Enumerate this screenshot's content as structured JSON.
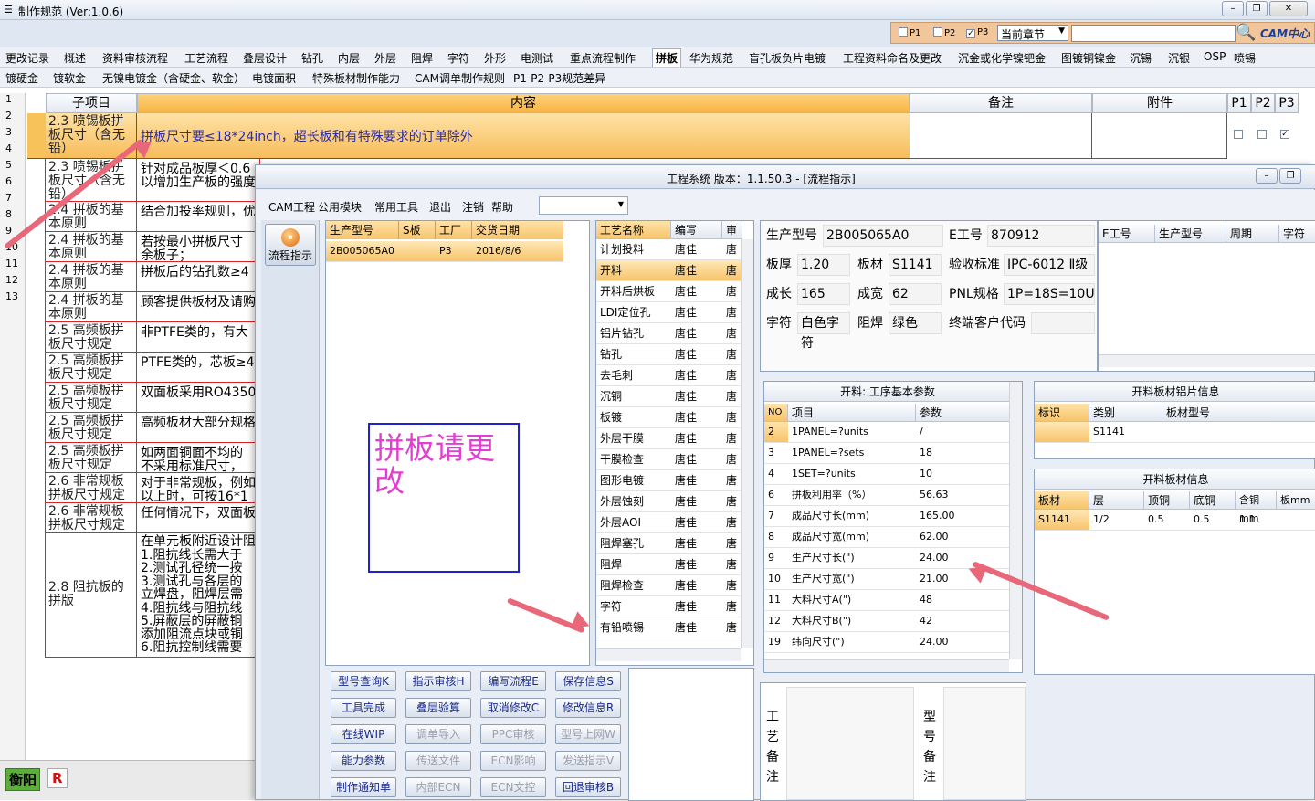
{
  "app": {
    "title": "制作规范 (Ver:1.0.6)"
  },
  "filter": {
    "p1": "P1",
    "p2": "P2",
    "p3": "P3",
    "scope": "当前章节",
    "logo": "CAM中心"
  },
  "tabs_row1": [
    "更改记录",
    "概述",
    "资料审核流程",
    "工艺流程",
    "叠层设计",
    "钻孔",
    "内层",
    "外层",
    "阻焊",
    "字符",
    "外形",
    "电测试",
    "重点流程制作",
    "拼板",
    "华为规范",
    "盲孔板负片电镀",
    "工程资料命名及更改",
    "沉金或化学镍钯金",
    "图镀铜镍金",
    "沉锡",
    "沉银",
    "OSP",
    "喷锡"
  ],
  "tabs_row2": [
    "镀硬金",
    "镀软金",
    "无镍电镀金（含硬金、软金）",
    "电镀面积",
    "特殊板材制作能力",
    "CAM调单制作规则",
    "P1-P2-P3规范差异"
  ],
  "grid": {
    "headers": {
      "sub": "子项目",
      "content": "内容",
      "remark": "备注",
      "attach": "附件",
      "p1": "P1",
      "p2": "P2",
      "p3": "P3"
    },
    "row_numbers": [
      "1",
      "2",
      "3",
      "4",
      "5",
      "6",
      "7",
      "8",
      "9",
      "10",
      "11",
      "12",
      "13"
    ],
    "rows": [
      {
        "sub": "2.3 喷锡板拼板尺寸（含无铅）",
        "content": "拼板尺寸要≤18*24inch，超长板和有特殊要求的订单除外"
      },
      {
        "sub": "2.3 喷锡板拼板尺寸（含无铅）",
        "content": "针对成品板厚＜0.6\n以增加生产板的强度"
      },
      {
        "sub": "2.4 拼板的基本原则",
        "content": "结合加投率规则，优"
      },
      {
        "sub": "2.4 拼板的基本原则",
        "content": "若按最小拼板尺寸\n余板子；"
      },
      {
        "sub": "2.4 拼板的基本原则",
        "content": "拼板后的钻孔数≥4"
      },
      {
        "sub": "2.4 拼板的基本原则",
        "content": "顾客提供板材及请购"
      },
      {
        "sub": "2.5 高频板拼板尺寸规定",
        "content": "非PTFE类的，有大"
      },
      {
        "sub": "2.5 高频板拼板尺寸规定",
        "content": "PTFE类的，芯板≥4"
      },
      {
        "sub": "2.5 高频板拼板尺寸规定",
        "content": "双面板采用RO4350"
      },
      {
        "sub": "2.5 高频板拼板尺寸规定",
        "content": "高频板材大部分规格"
      },
      {
        "sub": "2.5 高频板拼板尺寸规定",
        "content": "如两面铜面不均的\n不采用标准尺寸，"
      },
      {
        "sub": "2.6 非常规板拼板尺寸规定",
        "content": "对于非常规板，例如\n以上时，可按16*1"
      },
      {
        "sub": "2.6 非常规板拼板尺寸规定",
        "content": "任何情况下，双面板"
      },
      {
        "sub": "2.8 阻抗板的拼版",
        "content": "在单元板附近设计阻\n1.阻抗线长需大于\n2.测试孔径统一按\n3.测试孔与各层的\n立焊盘，阻焊层需\n4.阻抗线与阻抗线\n5.屏蔽层的屏蔽铜\n添加阻流点块或铜\n6.阻抗控制线需要"
      }
    ]
  },
  "status": {
    "site": "衡阳",
    "flag": "R"
  },
  "child": {
    "title": "工程系统  版本：1.1.50.3 - [流程指示]",
    "menu": [
      "CAM工程",
      "公用模块",
      "常用工具",
      "退出",
      "注销",
      "帮助"
    ],
    "nav_button": "流程指示",
    "jobs": {
      "headers": [
        "生产型号",
        "S板",
        "工厂",
        "交货日期"
      ],
      "rows": [
        {
          "model": "2B005065A0",
          "s": "",
          "factory": "P3",
          "date": "2016/8/6"
        }
      ]
    },
    "note_text": "拼板请更改",
    "process": {
      "headers": [
        "工艺名称",
        "编写",
        "审"
      ],
      "rows": [
        {
          "name": "计划投料",
          "author": "唐佳",
          "rev": "唐"
        },
        {
          "name": "开料",
          "author": "唐佳",
          "rev": "唐"
        },
        {
          "name": "开料后烘板",
          "author": "唐佳",
          "rev": "唐"
        },
        {
          "name": "LDI定位孔",
          "author": "唐佳",
          "rev": "唐"
        },
        {
          "name": "铝片钻孔",
          "author": "唐佳",
          "rev": "唐"
        },
        {
          "name": "钻孔",
          "author": "唐佳",
          "rev": "唐"
        },
        {
          "name": "去毛刺",
          "author": "唐佳",
          "rev": "唐"
        },
        {
          "name": "沉铜",
          "author": "唐佳",
          "rev": "唐"
        },
        {
          "name": "板镀",
          "author": "唐佳",
          "rev": "唐"
        },
        {
          "name": "外层干膜",
          "author": "唐佳",
          "rev": "唐"
        },
        {
          "name": "干膜检查",
          "author": "唐佳",
          "rev": "唐"
        },
        {
          "name": "图形电镀",
          "author": "唐佳",
          "rev": "唐"
        },
        {
          "name": "外层蚀刻",
          "author": "唐佳",
          "rev": "唐"
        },
        {
          "name": "外层AOI",
          "author": "唐佳",
          "rev": "唐"
        },
        {
          "name": "阻焊塞孔",
          "author": "唐佳",
          "rev": "唐"
        },
        {
          "name": "阻焊",
          "author": "唐佳",
          "rev": "唐"
        },
        {
          "name": "阻焊检查",
          "author": "唐佳",
          "rev": "唐"
        },
        {
          "name": "字符",
          "author": "唐佳",
          "rev": "唐"
        },
        {
          "name": "有铅喷锡",
          "author": "唐佳",
          "rev": "唐"
        }
      ]
    },
    "buttons": [
      [
        "型号查询K",
        "指示审核H",
        "编写流程E",
        "保存信息S"
      ],
      [
        "工具完成",
        "叠层验算",
        "取消修改C",
        "修改信息R"
      ],
      [
        "在线WIP",
        "调单导入",
        "PPC审核",
        "型号上网W"
      ],
      [
        "能力参数",
        "传送文件",
        "ECN影响",
        "发送指示V"
      ],
      [
        "制作通知单",
        "内部ECN",
        "ECN文控",
        "回退审核B"
      ]
    ],
    "info": {
      "model_label": "生产型号",
      "model": "2B005065A0",
      "eno_label": "E工号",
      "eno": "870912",
      "thick_label": "板厚",
      "thick": "1.20",
      "mat_label": "板材",
      "mat": "S1141",
      "std_label": "验收标准",
      "std": "IPC-6012 Ⅱ级",
      "len_label": "成长",
      "len": "165",
      "wid_label": "成宽",
      "wid": "62",
      "pnl_label": "PNL规格",
      "pnl": "1P=18S=10U",
      "char_label": "字符",
      "char": "白色字符",
      "mask_label": "阻焊",
      "mask": "绿色",
      "cust_label": "终端客户代码",
      "cust": ""
    },
    "history_headers": [
      "E工号",
      "生产型号",
      "周期",
      "字符"
    ],
    "params": {
      "title": "开料: 工序基本参数",
      "headers": [
        "NO",
        "项目",
        "参数"
      ],
      "rows": [
        {
          "no": "2",
          "item": "1PANEL=?units",
          "val": "/"
        },
        {
          "no": "3",
          "item": "1PANEL=?sets",
          "val": "18"
        },
        {
          "no": "4",
          "item": "1SET=?units",
          "val": "10"
        },
        {
          "no": "6",
          "item": "拼板利用率（%）",
          "val": "56.63"
        },
        {
          "no": "7",
          "item": "成品尺寸长(mm)",
          "val": "165.00"
        },
        {
          "no": "8",
          "item": "成品尺寸宽(mm)",
          "val": "62.00"
        },
        {
          "no": "9",
          "item": "生产尺寸长(\")",
          "val": "24.00"
        },
        {
          "no": "10",
          "item": "生产尺寸宽(\")",
          "val": "21.00"
        },
        {
          "no": "11",
          "item": "大料尺寸A(\")",
          "val": "48"
        },
        {
          "no": "12",
          "item": "大料尺寸B(\")",
          "val": "42"
        },
        {
          "no": "19",
          "item": "纬向尺寸(\")",
          "val": "24.00"
        }
      ]
    },
    "foil": {
      "title": "开料板材铝片信息",
      "headers": [
        "标识",
        "类别",
        "板材型号"
      ],
      "row": {
        "id": "",
        "cat": "S1141",
        "model": ""
      }
    },
    "material": {
      "title": "开料板材信息",
      "headers": [
        "板材",
        "层",
        "顶铜",
        "底铜",
        "含铜mm",
        "板mm"
      ],
      "row": {
        "mat": "S1141",
        "layer": "1/2",
        "top": "0.5",
        "bottom": "0.5",
        "cu": "1.1",
        "board": ""
      }
    },
    "remarks": {
      "process": "工艺备注",
      "model": "型号备注"
    }
  }
}
